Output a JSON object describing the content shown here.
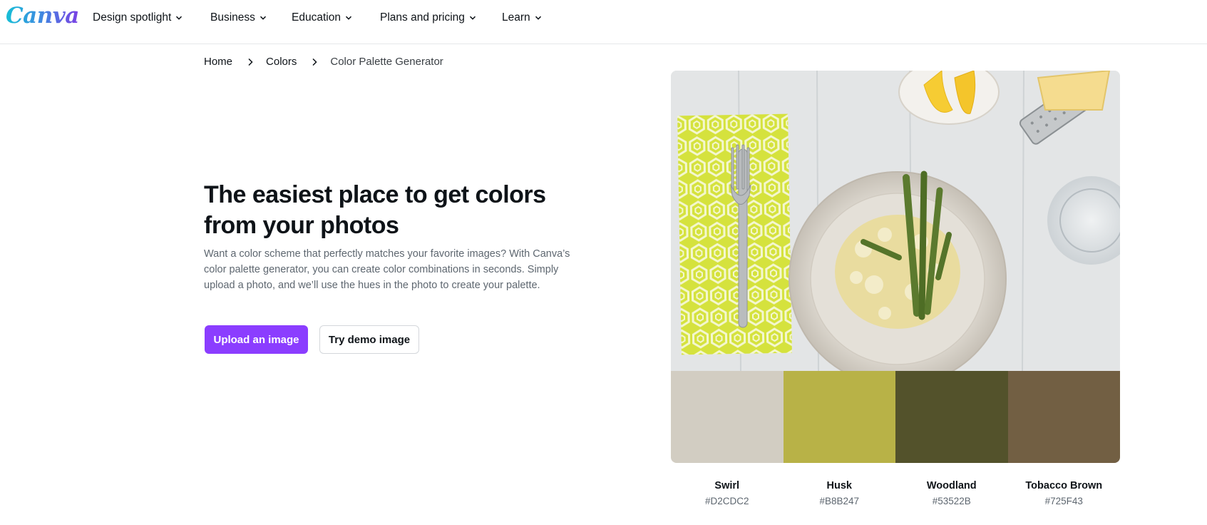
{
  "nav": {
    "logo": "Canva",
    "items": [
      {
        "label": "Design spotlight"
      },
      {
        "label": "Business"
      },
      {
        "label": "Education"
      },
      {
        "label": "Plans and pricing"
      },
      {
        "label": "Learn"
      }
    ]
  },
  "breadcrumb": [
    "Home",
    "Colors",
    "Color Palette Generator"
  ],
  "hero": {
    "title": "The easiest place to get colors from your photos",
    "description": "Want a color scheme that perfectly matches your favorite images? With Canva’s color palette generator, you can create color combinations in seconds. Simply upload a photo, and we’ll use the hues in the photo to create your palette.",
    "primary_button": "Upload an image",
    "secondary_button": "Try demo image"
  },
  "palette": [
    {
      "name": "Swirl",
      "hex": "#D2CDC2",
      "color": "#D2CDC2"
    },
    {
      "name": "Husk",
      "hex": "#B8B247",
      "color": "#B8B247"
    },
    {
      "name": "Woodland",
      "hex": "#53522B",
      "color": "#53522B"
    },
    {
      "name": "Tobacco Brown",
      "hex": "#725F43",
      "color": "#725F43"
    }
  ],
  "colors": {
    "accent": "#8B3DFF",
    "text": "#0E1318",
    "muted": "#5E6770"
  }
}
